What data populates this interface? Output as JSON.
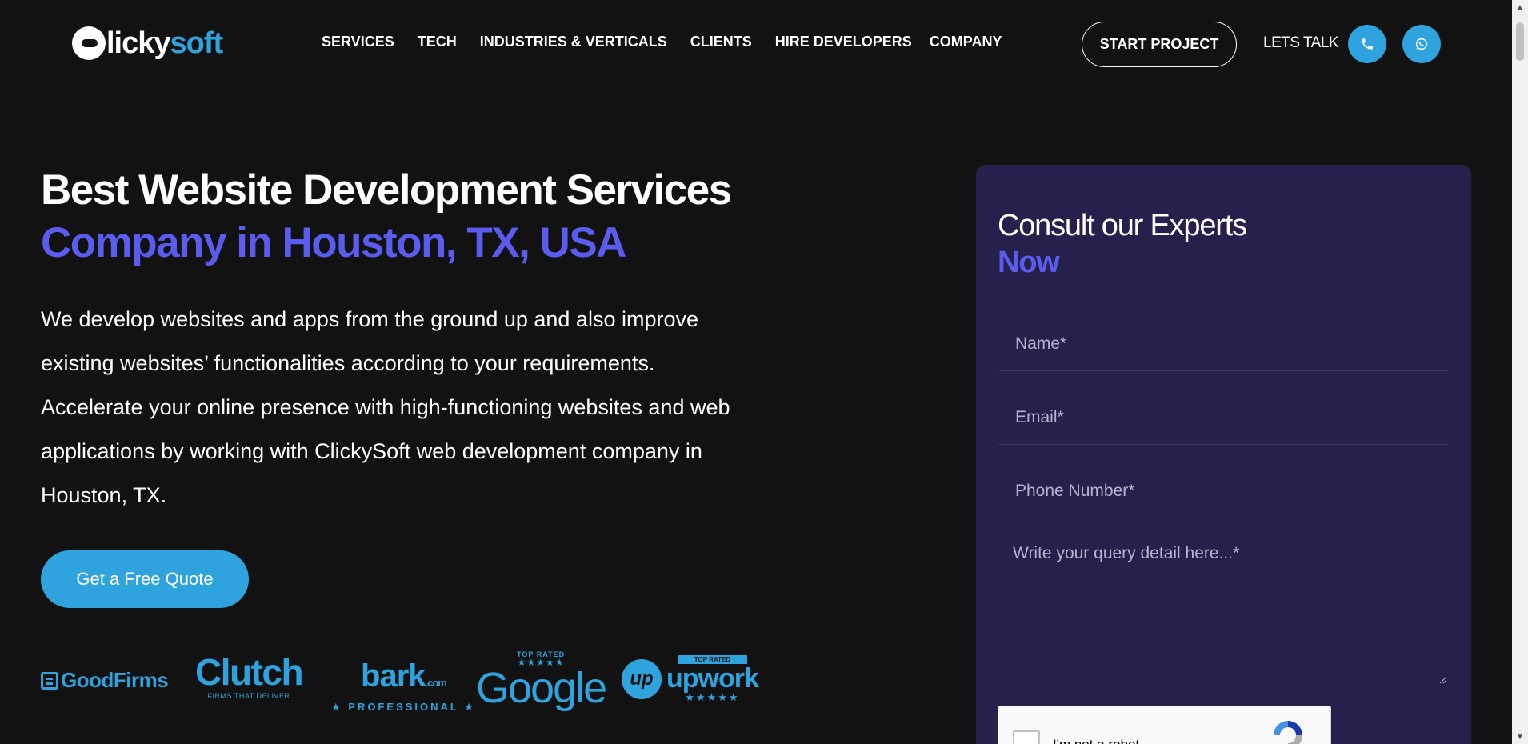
{
  "header": {
    "logo": {
      "text_white": "licky",
      "text_blue": "soft"
    },
    "nav": [
      "SERVICES",
      "TECH",
      "INDUSTRIES & VERTICALS",
      "CLIENTS",
      "HIRE DEVELOPERS",
      "COMPANY"
    ],
    "start_project": "START PROJECT",
    "lets_talk": "LETS TALK",
    "phone_icon": "phone-icon",
    "whatsapp_icon": "whatsapp-icon"
  },
  "hero": {
    "title_line1": "Best Website Development Services",
    "title_line2": "Company in Houston, TX, USA",
    "description": "We develop websites and apps from the ground up and also improve existing websites’ functionalities according to your requirements. Accelerate your online presence with high-functioning websites and web applications by working with ClickySoft web development company in Houston, TX.",
    "cta": "Get a Free Quote"
  },
  "badges": {
    "goodfirms": "GoodFirms",
    "clutch": "Clutch",
    "clutch_sub": "FIRMS THAT DELIVER",
    "bark": "bark",
    "bark_domain": ".com",
    "bark_sub": "★ PROFESSIONAL ★",
    "google_top": "TOP RATED",
    "google_stars": "★★★★★",
    "google": "Google",
    "upwork_logo": "up",
    "upwork_tag": "TOP RATED",
    "upwork": "upwork",
    "upwork_stars": "★★★★★"
  },
  "form": {
    "title_line1": "Consult our Experts",
    "title_line2": "Now",
    "name_placeholder": "Name*",
    "email_placeholder": "Email*",
    "phone_placeholder": "Phone Number*",
    "query_placeholder": "Write your query detail here...*",
    "captcha_label": "I'm not a robot"
  },
  "colors": {
    "background": "#121212",
    "accent_blue": "#2ea3dd",
    "accent_purple": "#5a5cf0",
    "card_bg": "#26204d"
  }
}
